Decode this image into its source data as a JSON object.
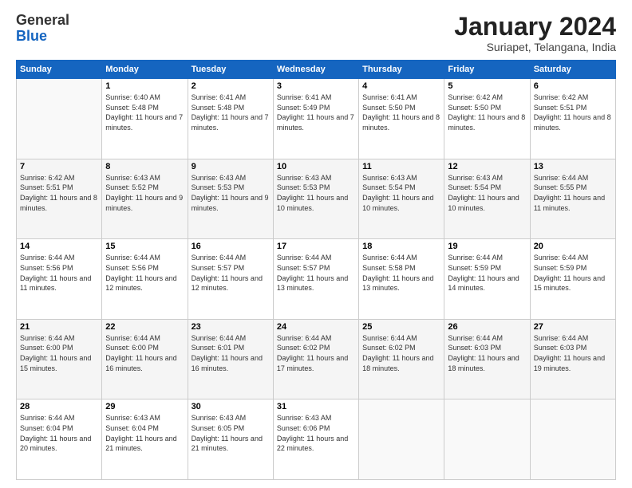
{
  "header": {
    "logo_general": "General",
    "logo_blue": "Blue",
    "month_title": "January 2024",
    "subtitle": "Suriapet, Telangana, India"
  },
  "days_of_week": [
    "Sunday",
    "Monday",
    "Tuesday",
    "Wednesday",
    "Thursday",
    "Friday",
    "Saturday"
  ],
  "weeks": [
    [
      {
        "day": "",
        "info": ""
      },
      {
        "day": "1",
        "info": "Sunrise: 6:40 AM\nSunset: 5:48 PM\nDaylight: 11 hours and 7 minutes."
      },
      {
        "day": "2",
        "info": "Sunrise: 6:41 AM\nSunset: 5:48 PM\nDaylight: 11 hours and 7 minutes."
      },
      {
        "day": "3",
        "info": "Sunrise: 6:41 AM\nSunset: 5:49 PM\nDaylight: 11 hours and 7 minutes."
      },
      {
        "day": "4",
        "info": "Sunrise: 6:41 AM\nSunset: 5:50 PM\nDaylight: 11 hours and 8 minutes."
      },
      {
        "day": "5",
        "info": "Sunrise: 6:42 AM\nSunset: 5:50 PM\nDaylight: 11 hours and 8 minutes."
      },
      {
        "day": "6",
        "info": "Sunrise: 6:42 AM\nSunset: 5:51 PM\nDaylight: 11 hours and 8 minutes."
      }
    ],
    [
      {
        "day": "7",
        "info": "Sunrise: 6:42 AM\nSunset: 5:51 PM\nDaylight: 11 hours and 8 minutes."
      },
      {
        "day": "8",
        "info": "Sunrise: 6:43 AM\nSunset: 5:52 PM\nDaylight: 11 hours and 9 minutes."
      },
      {
        "day": "9",
        "info": "Sunrise: 6:43 AM\nSunset: 5:53 PM\nDaylight: 11 hours and 9 minutes."
      },
      {
        "day": "10",
        "info": "Sunrise: 6:43 AM\nSunset: 5:53 PM\nDaylight: 11 hours and 10 minutes."
      },
      {
        "day": "11",
        "info": "Sunrise: 6:43 AM\nSunset: 5:54 PM\nDaylight: 11 hours and 10 minutes."
      },
      {
        "day": "12",
        "info": "Sunrise: 6:43 AM\nSunset: 5:54 PM\nDaylight: 11 hours and 10 minutes."
      },
      {
        "day": "13",
        "info": "Sunrise: 6:44 AM\nSunset: 5:55 PM\nDaylight: 11 hours and 11 minutes."
      }
    ],
    [
      {
        "day": "14",
        "info": "Sunrise: 6:44 AM\nSunset: 5:56 PM\nDaylight: 11 hours and 11 minutes."
      },
      {
        "day": "15",
        "info": "Sunrise: 6:44 AM\nSunset: 5:56 PM\nDaylight: 11 hours and 12 minutes."
      },
      {
        "day": "16",
        "info": "Sunrise: 6:44 AM\nSunset: 5:57 PM\nDaylight: 11 hours and 12 minutes."
      },
      {
        "day": "17",
        "info": "Sunrise: 6:44 AM\nSunset: 5:57 PM\nDaylight: 11 hours and 13 minutes."
      },
      {
        "day": "18",
        "info": "Sunrise: 6:44 AM\nSunset: 5:58 PM\nDaylight: 11 hours and 13 minutes."
      },
      {
        "day": "19",
        "info": "Sunrise: 6:44 AM\nSunset: 5:59 PM\nDaylight: 11 hours and 14 minutes."
      },
      {
        "day": "20",
        "info": "Sunrise: 6:44 AM\nSunset: 5:59 PM\nDaylight: 11 hours and 15 minutes."
      }
    ],
    [
      {
        "day": "21",
        "info": "Sunrise: 6:44 AM\nSunset: 6:00 PM\nDaylight: 11 hours and 15 minutes."
      },
      {
        "day": "22",
        "info": "Sunrise: 6:44 AM\nSunset: 6:00 PM\nDaylight: 11 hours and 16 minutes."
      },
      {
        "day": "23",
        "info": "Sunrise: 6:44 AM\nSunset: 6:01 PM\nDaylight: 11 hours and 16 minutes."
      },
      {
        "day": "24",
        "info": "Sunrise: 6:44 AM\nSunset: 6:02 PM\nDaylight: 11 hours and 17 minutes."
      },
      {
        "day": "25",
        "info": "Sunrise: 6:44 AM\nSunset: 6:02 PM\nDaylight: 11 hours and 18 minutes."
      },
      {
        "day": "26",
        "info": "Sunrise: 6:44 AM\nSunset: 6:03 PM\nDaylight: 11 hours and 18 minutes."
      },
      {
        "day": "27",
        "info": "Sunrise: 6:44 AM\nSunset: 6:03 PM\nDaylight: 11 hours and 19 minutes."
      }
    ],
    [
      {
        "day": "28",
        "info": "Sunrise: 6:44 AM\nSunset: 6:04 PM\nDaylight: 11 hours and 20 minutes."
      },
      {
        "day": "29",
        "info": "Sunrise: 6:43 AM\nSunset: 6:04 PM\nDaylight: 11 hours and 21 minutes."
      },
      {
        "day": "30",
        "info": "Sunrise: 6:43 AM\nSunset: 6:05 PM\nDaylight: 11 hours and 21 minutes."
      },
      {
        "day": "31",
        "info": "Sunrise: 6:43 AM\nSunset: 6:06 PM\nDaylight: 11 hours and 22 minutes."
      },
      {
        "day": "",
        "info": ""
      },
      {
        "day": "",
        "info": ""
      },
      {
        "day": "",
        "info": ""
      }
    ]
  ]
}
